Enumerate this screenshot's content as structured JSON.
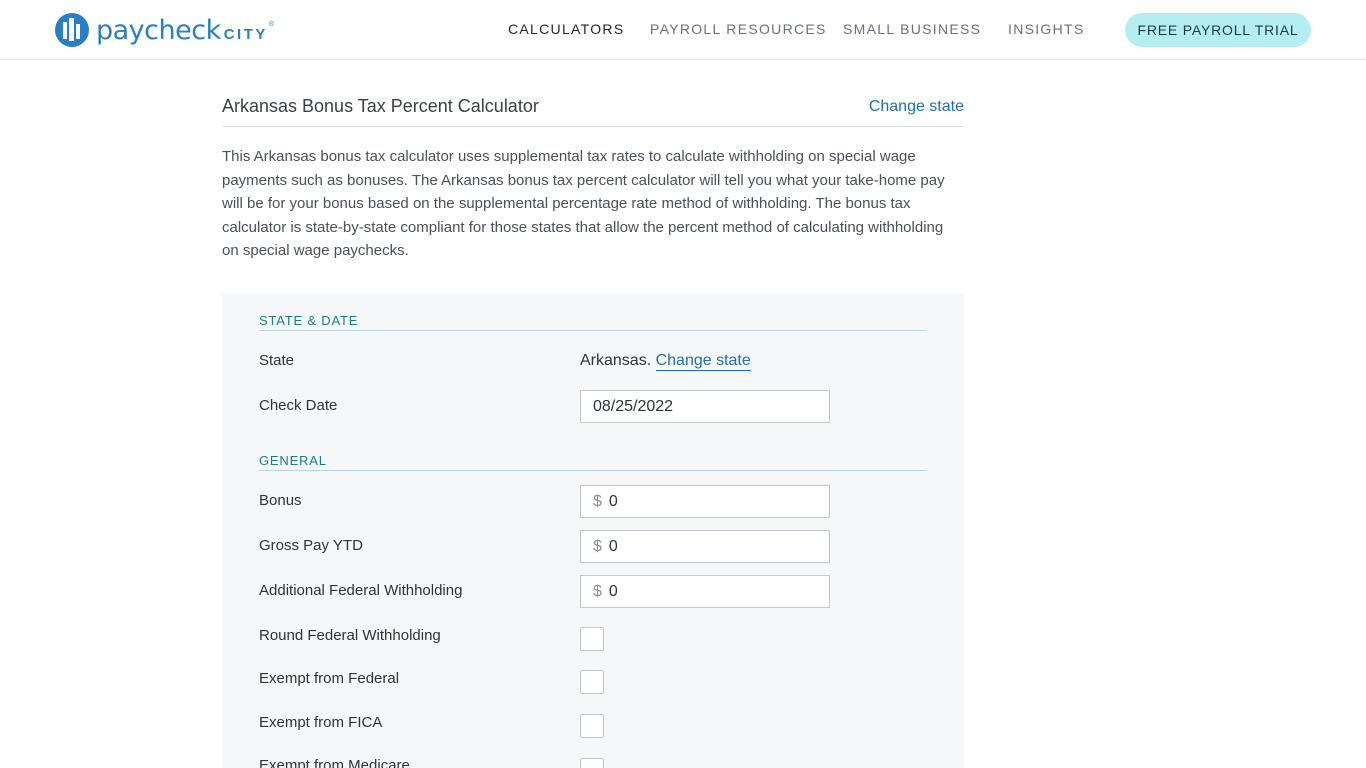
{
  "header": {
    "logo": {
      "word": "paycheck",
      "word2": "CITY",
      "mark": "®"
    },
    "nav": {
      "calculators": "CALCULATORS",
      "payroll_resources": "PAYROLL RESOURCES",
      "small_business": "SMALL BUSINESS",
      "insights": "INSIGHTS"
    },
    "cta": "FREE PAYROLL TRIAL"
  },
  "page": {
    "title": "Arkansas Bonus Tax Percent Calculator",
    "change_state": "Change state",
    "intro": "This Arkansas bonus tax calculator uses supplemental tax rates to calculate withholding on special wage payments such as bonuses. The Arkansas bonus tax percent calculator will tell you what your take-home pay will be for your bonus based on the supplemental percentage rate method of withholding. The bonus tax calculator is state-by-state compliant for those states that allow the percent method of calculating withholding on special wage paychecks."
  },
  "form": {
    "state_date": {
      "heading": "STATE & DATE",
      "state_label": "State",
      "state_value": "Arkansas.",
      "change_state_link": "Change state",
      "check_date_label": "Check Date",
      "check_date_value": "08/25/2022"
    },
    "general": {
      "heading": "GENERAL",
      "currency_symbol": "$",
      "bonus_label": "Bonus",
      "bonus_value": "0",
      "gross_pay_ytd_label": "Gross Pay YTD",
      "gross_pay_ytd_value": "0",
      "additional_federal_label": "Additional Federal Withholding",
      "additional_federal_value": "0",
      "round_federal_label": "Round Federal Withholding",
      "exempt_federal_label": "Exempt from Federal",
      "exempt_fica_label": "Exempt from FICA",
      "exempt_medicare_label": "Exempt from Medicare"
    }
  },
  "colors": {
    "brand_blue": "#2a7fc4",
    "link_blue": "#1f6fb2",
    "section_teal": "#1e7a8a",
    "cta_bg": "#b5eef2"
  }
}
